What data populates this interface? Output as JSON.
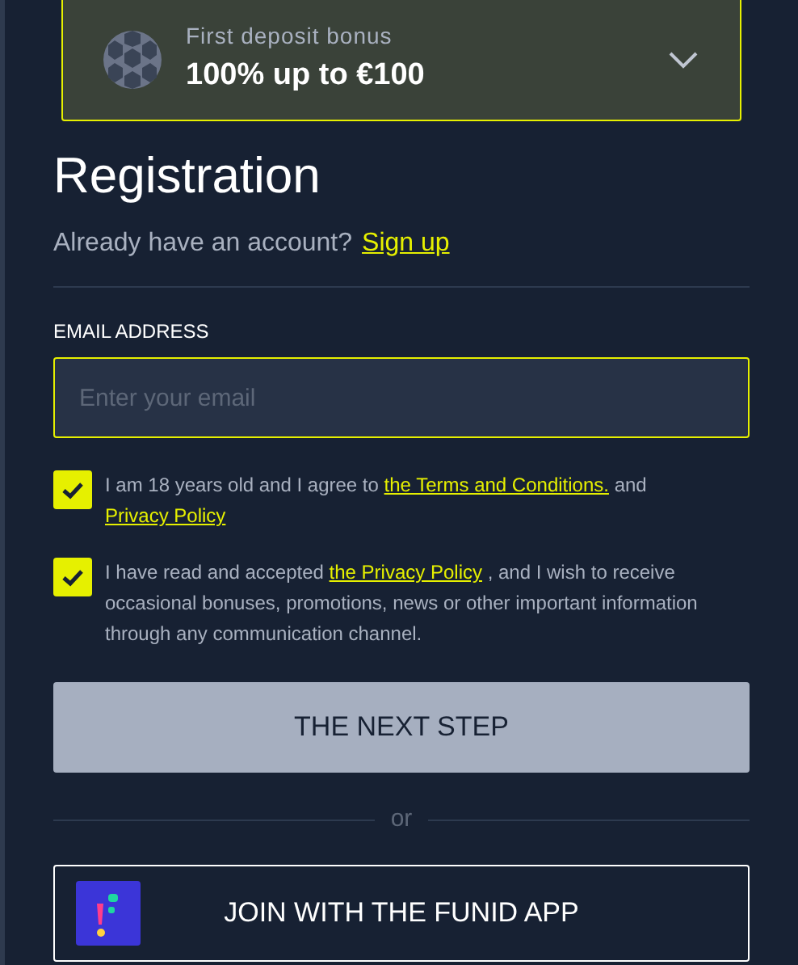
{
  "bonus": {
    "label": "First deposit bonus",
    "amount": "100% up to €100",
    "expanded": false
  },
  "title": "Registration",
  "login_prompt": {
    "text": "Already have an account?",
    "link": "Sign up"
  },
  "email": {
    "label": "EMAIL ADDRESS",
    "placeholder": "Enter your email"
  },
  "consents": [
    {
      "checked": true,
      "parts": [
        {
          "kind": "text",
          "text": "I am 18 years old and I agree to"
        },
        {
          "kind": "link",
          "text": "the Terms and Conditions."
        },
        {
          "kind": "text",
          "text": "and"
        },
        {
          "kind": "link",
          "text": "Privacy Policy"
        }
      ]
    },
    {
      "checked": true,
      "parts": [
        {
          "kind": "text",
          "text": "I have read and accepted"
        },
        {
          "kind": "link",
          "text": "the Privacy Policy"
        },
        {
          "kind": "text",
          "text": ", and I wish to receive occasional bonuses, promotions, news or other important information through any communication channel."
        }
      ]
    }
  ],
  "next_button": "THE NEXT STEP",
  "divider_text": "or",
  "app_button": "JOIN WITH THE FUNID APP"
}
